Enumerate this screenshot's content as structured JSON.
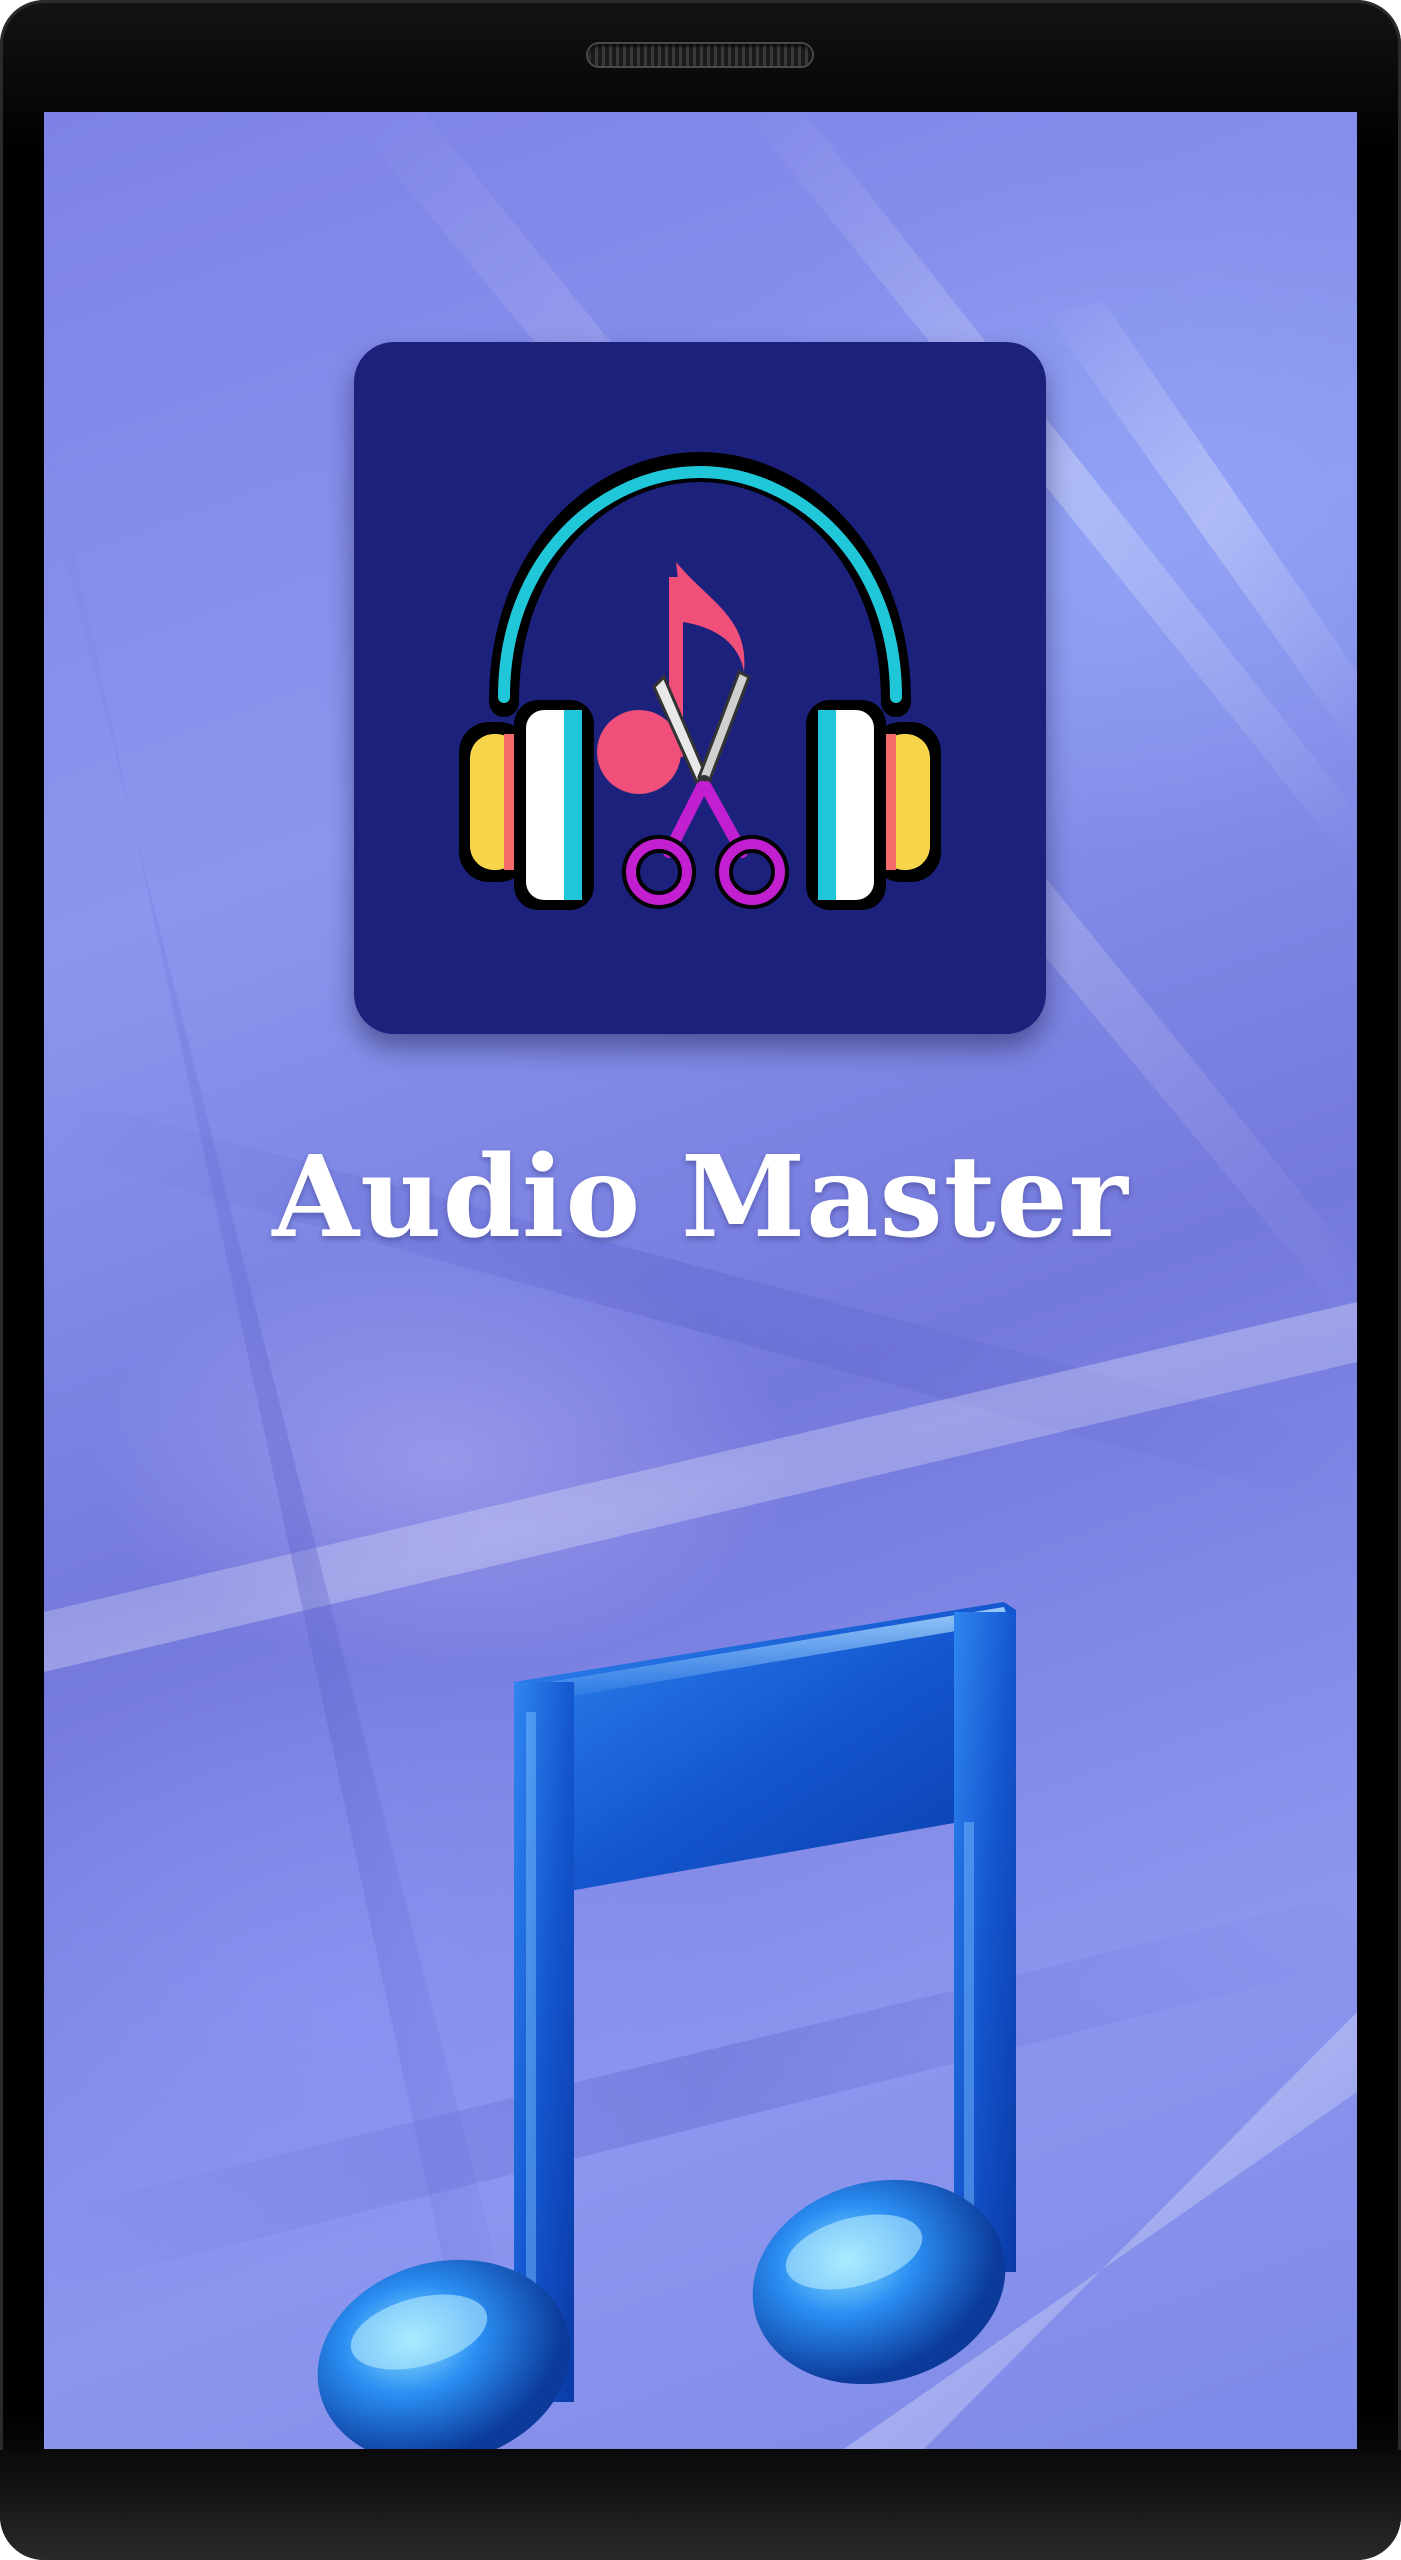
{
  "app": {
    "title": "Audio Master"
  },
  "icons": {
    "app_icon": "headphones-scissors-music-icon",
    "hero": "music-note-icon"
  },
  "colors": {
    "icon_background": "#1c227c",
    "title_text": "#ffffff",
    "note_blue": "#1b5fd4",
    "screen_background": "#8189e8"
  }
}
